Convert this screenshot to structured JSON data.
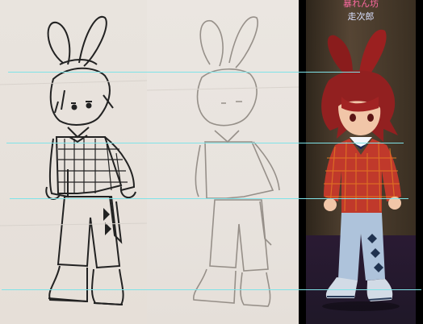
{
  "character": {
    "guild_name": "暴れん坊",
    "character_name": "走次郎"
  },
  "colors": {
    "guide_line": "#7fe3e8",
    "guild_name_color": "#ff6aa3",
    "character_name_color": "#d9e0ff",
    "hair": "#8f1f1f",
    "jacket": "#c0392b",
    "pants": "#aec3db"
  }
}
